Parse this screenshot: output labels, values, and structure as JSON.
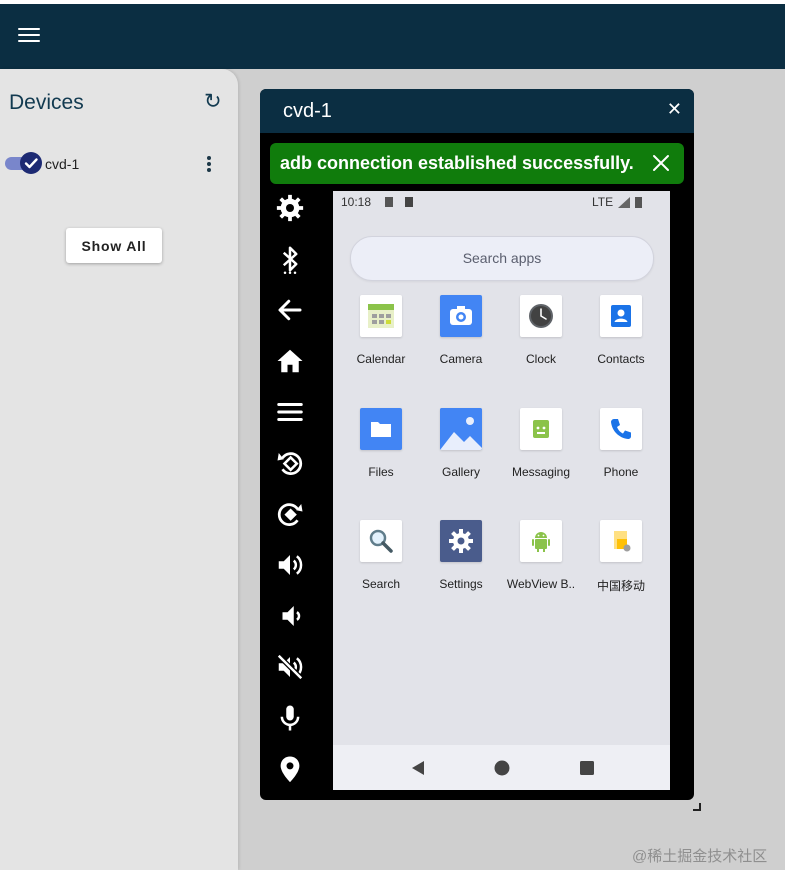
{
  "app_bar": {
    "menu_icon": "hamburger-menu-icon"
  },
  "sidebar": {
    "title": "Devices",
    "refresh_icon": "↻",
    "devices": [
      {
        "name": "cvd-1",
        "enabled": true
      }
    ],
    "show_all_label": "Show All"
  },
  "device_window": {
    "title": "cvd-1",
    "close_icon": "✕"
  },
  "toast": {
    "message": "adb connection established successfully."
  },
  "controls": [
    "gear-icon",
    "bluetooth-icon",
    "back-arrow-icon",
    "home-icon",
    "menu-icon",
    "rotate-left-icon",
    "rotate-right-icon",
    "volume-up-icon",
    "volume-down-icon",
    "volume-mute-icon",
    "microphone-icon",
    "location-icon"
  ],
  "phone": {
    "status_time": "10:18",
    "status_network": "LTE",
    "search_placeholder": "Search apps",
    "apps": [
      {
        "label": "Calendar",
        "icon": "calendar-icon",
        "color": "#8bc34a"
      },
      {
        "label": "Camera",
        "icon": "camera-icon",
        "color": "#4285f4"
      },
      {
        "label": "Clock",
        "icon": "clock-icon",
        "color": "#5f6368"
      },
      {
        "label": "Contacts",
        "icon": "contacts-icon",
        "color": "#1a73e8"
      },
      {
        "label": "Files",
        "icon": "files-icon",
        "color": "#4285f4"
      },
      {
        "label": "Gallery",
        "icon": "gallery-icon",
        "color": "#4285f4"
      },
      {
        "label": "Messaging",
        "icon": "messaging-icon",
        "color": "#8bc34a"
      },
      {
        "label": "Phone",
        "icon": "phone-icon",
        "color": "#1a73e8"
      },
      {
        "label": "Search",
        "icon": "search-icon",
        "color": "#607d8b"
      },
      {
        "label": "Settings",
        "icon": "settings-icon",
        "color": "#4a5c8c"
      },
      {
        "label": "WebView B..",
        "icon": "android-icon",
        "color": "#8bc34a"
      },
      {
        "label": "中国移动",
        "icon": "china-mobile-icon",
        "color": "#ffc107"
      }
    ]
  },
  "watermark": "@稀土掘金技术社区"
}
